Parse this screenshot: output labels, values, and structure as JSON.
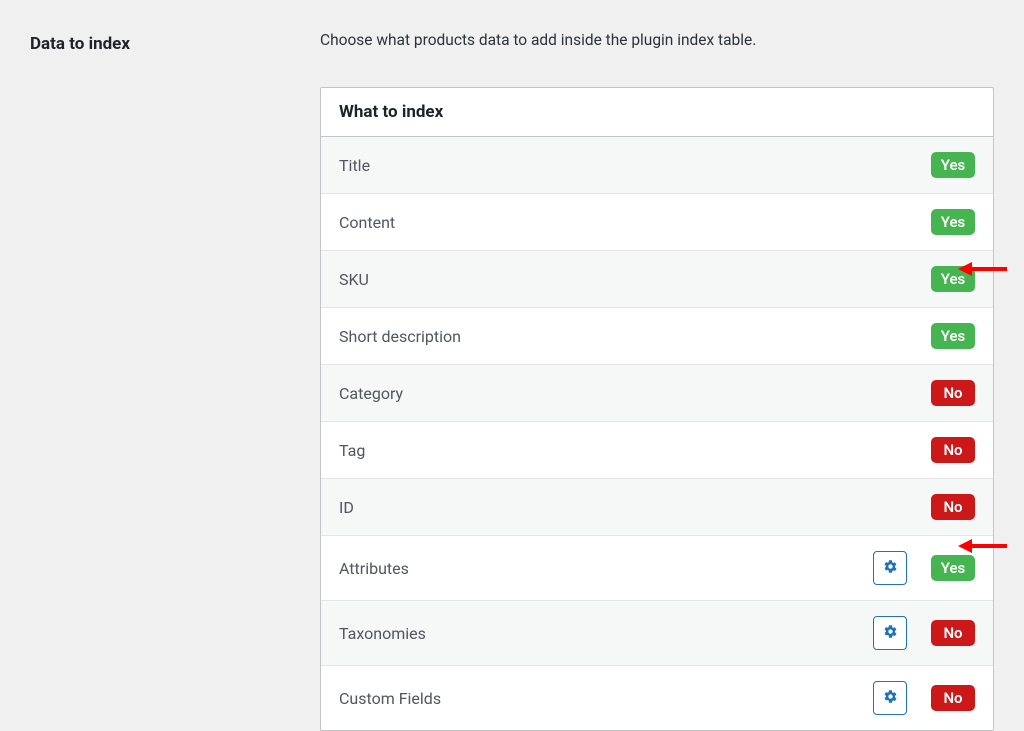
{
  "section_title": "Data to index",
  "description": "Choose what products data to add inside the plugin index table.",
  "panel_header": "What to index",
  "badge_yes": "Yes",
  "badge_no": "No",
  "rows": [
    {
      "label": "Title",
      "value": "Yes",
      "gear": false,
      "arrow": false
    },
    {
      "label": "Content",
      "value": "Yes",
      "gear": false,
      "arrow": false
    },
    {
      "label": "SKU",
      "value": "Yes",
      "gear": false,
      "arrow": true
    },
    {
      "label": "Short description",
      "value": "Yes",
      "gear": false,
      "arrow": false
    },
    {
      "label": "Category",
      "value": "No",
      "gear": false,
      "arrow": false
    },
    {
      "label": "Tag",
      "value": "No",
      "gear": false,
      "arrow": false
    },
    {
      "label": "ID",
      "value": "No",
      "gear": false,
      "arrow": false
    },
    {
      "label": "Attributes",
      "value": "Yes",
      "gear": true,
      "arrow": true
    },
    {
      "label": "Taxonomies",
      "value": "No",
      "gear": true,
      "arrow": false
    },
    {
      "label": "Custom Fields",
      "value": "No",
      "gear": true,
      "arrow": false
    }
  ]
}
